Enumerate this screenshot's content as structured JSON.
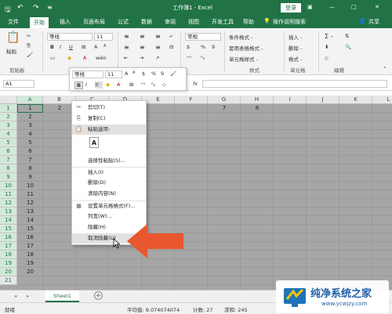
{
  "titlebar": {
    "save_icon": "save-icon",
    "undo_icon": "undo-icon",
    "redo_icon": "redo-icon",
    "title": "工作簿1 - Excel",
    "login": "登录",
    "minimize": "—",
    "restore": "□",
    "close": "✕"
  },
  "tabs": [
    "文件",
    "开始",
    "插入",
    "页面布局",
    "公式",
    "数据",
    "审阅",
    "视图",
    "开发工具",
    "帮助"
  ],
  "tell_me": "操作说明搜索",
  "share": "共享",
  "ribbon": {
    "paste": "粘贴",
    "clipboard": "剪贴板",
    "font_name": "等线",
    "font_size": "11",
    "bold": "B",
    "italic": "I",
    "underline": "U",
    "font_a": "A",
    "font_color_a": "A",
    "wen": "wén",
    "number_format": "常规",
    "percent": "%",
    "comma": "9",
    "cond_format": "条件格式 -",
    "table_format": "套用表格格式 -",
    "cell_style": "单元格样式 -",
    "style_group": "样式",
    "insert": "插入 -",
    "delete": "删除 -",
    "format": "格式 -",
    "cells_group": "单元格",
    "sum": "Σ -",
    "edit_group": "编辑"
  },
  "namebox": "A1",
  "fx": "fx",
  "minitool": {
    "font": "等线",
    "size": "11",
    "bold": "B",
    "italic": "I",
    "underline": "",
    "percent": "%",
    "comma": "9"
  },
  "columns": [
    "A",
    "B",
    "C",
    "D",
    "E",
    "F",
    "G",
    "H",
    "I",
    "J",
    "K",
    "L",
    "M"
  ],
  "rows": [
    "1",
    "2",
    "3",
    "4",
    "5",
    "6",
    "7",
    "8",
    "9",
    "10",
    "11",
    "12",
    "13",
    "14",
    "15",
    "16",
    "17",
    "18",
    "19",
    "20",
    "21"
  ],
  "row1_values": {
    "A": "1",
    "B": "2",
    "G": "7",
    "H": "8"
  },
  "colA_values": [
    "1",
    "2",
    "3",
    "4",
    "5",
    "6",
    "7",
    "8",
    "9",
    "10",
    "11",
    "12",
    "13",
    "14",
    "15",
    "16",
    "17",
    "18",
    "19",
    "20"
  ],
  "context_menu": [
    {
      "label": "剪切(T)",
      "icon": "scissors-icon"
    },
    {
      "label": "复制(C)",
      "icon": "copy-icon"
    },
    {
      "label": "粘贴选项:",
      "icon": "paste-icon"
    },
    {
      "label": "A",
      "icon": ""
    },
    {
      "label": "选择性粘贴(S)...",
      "icon": ""
    },
    {
      "label": "插入(I)",
      "icon": ""
    },
    {
      "label": "删除(D)",
      "icon": ""
    },
    {
      "label": "清除内容(N)",
      "icon": ""
    },
    {
      "label": "设置单元格格式(F)...",
      "icon": "format-cells-icon"
    },
    {
      "label": "列宽(W)...",
      "icon": ""
    },
    {
      "label": "隐藏(H)",
      "icon": ""
    },
    {
      "label": "取消隐藏(U)",
      "icon": ""
    }
  ],
  "sheet_tab": "Sheet1",
  "add_sheet": "+",
  "status": {
    "ready": "就绪",
    "average": "平均值: 9.074074074",
    "count": "计数: 27",
    "sum": "求和: 245"
  },
  "watermark": {
    "brand": "纯净系统之家",
    "url": "www.ycwjzy.com"
  },
  "colors": {
    "brand": "#217346",
    "arrow": "#e8572e",
    "grid_grey": "#a6a6a6"
  }
}
